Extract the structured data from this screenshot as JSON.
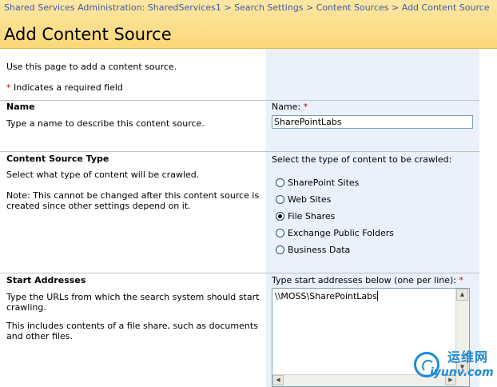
{
  "breadcrumb": {
    "item1": "Shared Services Administration: SharedServices1",
    "item2": "Search Settings",
    "item3": "Content Sources",
    "current": "Add Content Source",
    "separator": ">"
  },
  "page_title": "Add Content Source",
  "intro": "Use this page to add a content source.",
  "required_note": "Indicates a required field",
  "required_marker": "*",
  "name_section": {
    "title": "Name",
    "description": "Type a name to describe this content source.",
    "field_label": "Name:",
    "value": "SharePointLabs"
  },
  "type_section": {
    "title": "Content Source Type",
    "description": "Select what type of content will be crawled.",
    "note": "Note: This cannot be changed after this content source is created since other settings depend on it.",
    "field_label": "Select the type of content to be crawled:",
    "options": [
      {
        "label": "SharePoint Sites",
        "checked": false
      },
      {
        "label": "Web Sites",
        "checked": false
      },
      {
        "label": "File Shares",
        "checked": true
      },
      {
        "label": "Exchange Public Folders",
        "checked": false
      },
      {
        "label": "Business Data",
        "checked": false
      }
    ]
  },
  "start_section": {
    "title": "Start Addresses",
    "description": "Type the URLs from which the search system should start crawling.",
    "note": "This includes contents of a file share, such as documents and other files.",
    "field_label": "Type start addresses below (one per line):",
    "value": "\\\\MOSS\\SharePointLabs"
  },
  "watermark": {
    "cn": "运维网",
    "url": "iyunv.com"
  },
  "colors": {
    "header_bg": "#fbd878",
    "link": "#3b5da6",
    "required": "#d00000",
    "field_panel": "#eaf0fc"
  }
}
